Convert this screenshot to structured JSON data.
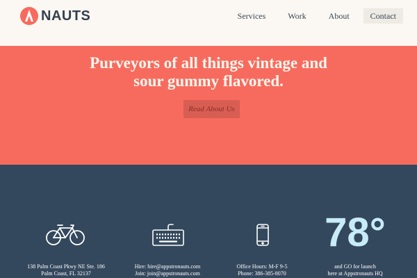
{
  "brand": {
    "name": "NAUTS",
    "accent": "#f76b5e"
  },
  "nav": {
    "items": [
      {
        "label": "Services"
      },
      {
        "label": "Work"
      },
      {
        "label": "About"
      },
      {
        "label": "Contact",
        "active": true
      }
    ]
  },
  "hero": {
    "line1": "Purveyors of all things vintage and",
    "line2": "sour gummy flavored.",
    "cta_label": "Read About Us",
    "background": "#f76b5e"
  },
  "footer": {
    "background": "#34485d",
    "address": {
      "icon": "bicycle-icon",
      "line1": "138 Palm Coast Pkwy NE Ste. 186",
      "line2": "Palm Coast,  FL 32137"
    },
    "contact": {
      "icon": "keyboard-icon",
      "line1": "Hire:  hire@appstronauts.com",
      "line2": "Join:  join@appstronauts.com"
    },
    "office": {
      "icon": "phone-icon",
      "line1": "Office Hours:  M-F 9-5",
      "line2": "Phone: 386-385-8070"
    },
    "weather": {
      "temperature": "78°",
      "line1": "and GO for launch",
      "line2": "here at Appstronauts HQ"
    }
  }
}
